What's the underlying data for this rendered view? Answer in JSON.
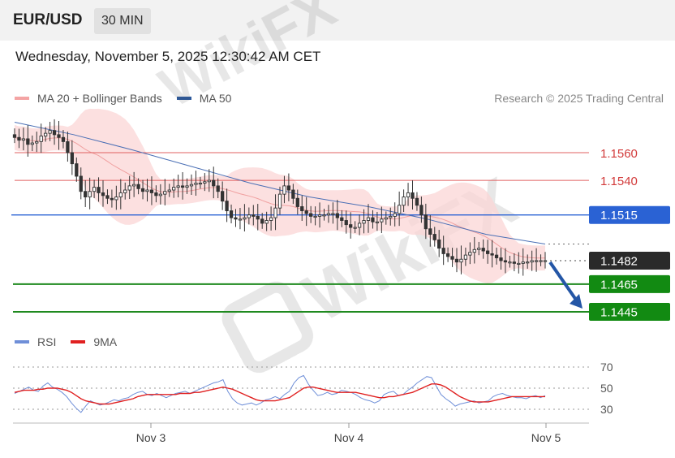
{
  "header": {
    "pair": "EUR/USD",
    "timeframe": "30 MIN",
    "timestamp": "Wednesday, November 5, 2025 12:30:42 AM CET"
  },
  "legend": {
    "ma20": {
      "label": "MA 20 + Bollinger Bands",
      "color": "#f4a4a4"
    },
    "ma50": {
      "label": "MA 50",
      "color": "#2c5aa0"
    }
  },
  "credit": "Research © 2025 Trading Central",
  "rsi_legend": {
    "rsi": {
      "label": "RSI",
      "color": "#6f8fd8"
    },
    "ma9": {
      "label": "9MA",
      "color": "#e02020"
    }
  },
  "watermark": "WikiFX",
  "chart_data": [
    {
      "type": "candlestick",
      "title": "",
      "ylim": [
        1.1425,
        1.1595
      ],
      "levels": [
        {
          "value": 1.156,
          "label": "1.1560",
          "kind": "resistance",
          "color": "#e06060"
        },
        {
          "value": 1.154,
          "label": "1.1540",
          "kind": "resistance",
          "color": "#e06060"
        },
        {
          "value": 1.1515,
          "label": "1.1515",
          "kind": "pivot",
          "color": "#2a62d4"
        },
        {
          "value": 1.1482,
          "label": "1.1482",
          "kind": "current",
          "color": "#2a2a2a"
        },
        {
          "value": 1.1465,
          "label": "1.1465",
          "kind": "support",
          "color": "#1f8a1f"
        },
        {
          "value": 1.1445,
          "label": "1.1445",
          "kind": "support",
          "color": "#1f8a1f"
        }
      ],
      "x_ticks": [
        {
          "label": "Nov 3",
          "index": 37
        },
        {
          "label": "Nov 4",
          "index": 85
        },
        {
          "value": "Nov 5",
          "label": "Nov 5",
          "index": 133
        }
      ],
      "close_series": [
        1.1571,
        1.1569,
        1.157,
        1.1566,
        1.1567,
        1.1568,
        1.1572,
        1.1574,
        1.1576,
        1.1573,
        1.1571,
        1.1568,
        1.156,
        1.1552,
        1.1543,
        1.1532,
        1.1528,
        1.1532,
        1.1535,
        1.1531,
        1.1529,
        1.1527,
        1.1526,
        1.1528,
        1.1531,
        1.1533,
        1.1536,
        1.1537,
        1.1534,
        1.1532,
        1.1533,
        1.1531,
        1.1529,
        1.153,
        1.1532,
        1.1533,
        1.1535,
        1.1536,
        1.1535,
        1.1536,
        1.1537,
        1.1538,
        1.1538,
        1.1539,
        1.154,
        1.1536,
        1.1532,
        1.1525,
        1.1518,
        1.1513,
        1.1512,
        1.1512,
        1.1513,
        1.1515,
        1.1514,
        1.1512,
        1.1509,
        1.1511,
        1.1513,
        1.152,
        1.153,
        1.1536,
        1.1533,
        1.1527,
        1.1521,
        1.1518,
        1.1516,
        1.1514,
        1.1514,
        1.1515,
        1.1515,
        1.1516,
        1.1516,
        1.1513,
        1.1511,
        1.1508,
        1.1506,
        1.1506,
        1.1509,
        1.1511,
        1.1513,
        1.151,
        1.151,
        1.1512,
        1.1513,
        1.1514,
        1.1516,
        1.1522,
        1.1528,
        1.1531,
        1.1527,
        1.1522,
        1.1515,
        1.1505,
        1.1501,
        1.1497,
        1.1491,
        1.1487,
        1.1485,
        1.1483,
        1.1481,
        1.1483,
        1.1486,
        1.1488,
        1.149,
        1.1491,
        1.1489,
        1.1487,
        1.1486,
        1.1484,
        1.1482,
        1.1481,
        1.1481,
        1.148,
        1.148,
        1.1481,
        1.1481,
        1.1482,
        1.1482,
        1.1482,
        1.1482
      ],
      "ma50_series": [
        1.1582,
        1.1573,
        1.1562,
        1.155,
        1.1538,
        1.1528,
        1.1521,
        1.1512,
        1.1501,
        1.1494
      ],
      "forecast_arrow": {
        "from": 1.1482,
        "to": 1.1445
      }
    },
    {
      "type": "line",
      "title": "",
      "ylim": [
        20,
        80
      ],
      "y_ticks": [
        70,
        50,
        30
      ],
      "series": [
        {
          "name": "RSI",
          "values": [
            45,
            47,
            49,
            51,
            48,
            47,
            52,
            55,
            51,
            49,
            46,
            42,
            36,
            31,
            27,
            33,
            38,
            36,
            34,
            35,
            37,
            39,
            38,
            40,
            41,
            44,
            46,
            47,
            44,
            43,
            45,
            43,
            41,
            43,
            45,
            46,
            47,
            45,
            47,
            49,
            51,
            53,
            55,
            56,
            58,
            47,
            40,
            36,
            34,
            35,
            36,
            34,
            36,
            39,
            40,
            42,
            40,
            44,
            47,
            55,
            60,
            62,
            54,
            48,
            43,
            44,
            46,
            44,
            45,
            48,
            47,
            46,
            44,
            41,
            39,
            38,
            36,
            38,
            44,
            46,
            47,
            43,
            44,
            48,
            51,
            55,
            58,
            61,
            60,
            52,
            44,
            40,
            37,
            33,
            35,
            36,
            37,
            38,
            36,
            37,
            38,
            42,
            44,
            45,
            43,
            42,
            41,
            41,
            40,
            42,
            43,
            41,
            43
          ]
        },
        {
          "name": "9MA",
          "values": [
            46,
            47,
            48,
            48,
            48,
            49,
            49,
            50,
            50,
            50,
            49,
            48,
            46,
            43,
            40,
            38,
            37,
            36,
            35,
            35,
            35,
            36,
            37,
            38,
            39,
            40,
            42,
            43,
            44,
            44,
            44,
            44,
            44,
            44,
            44,
            45,
            45,
            45,
            46,
            46,
            47,
            48,
            49,
            50,
            51,
            50,
            49,
            47,
            45,
            43,
            41,
            39,
            38,
            38,
            38,
            38,
            39,
            40,
            41,
            44,
            47,
            50,
            51,
            51,
            50,
            49,
            48,
            47,
            46,
            46,
            46,
            46,
            46,
            45,
            44,
            43,
            42,
            41,
            41,
            42,
            42,
            43,
            44,
            45,
            46,
            48,
            50,
            52,
            54,
            54,
            53,
            51,
            48,
            45,
            42,
            40,
            38,
            37,
            37,
            37,
            37,
            38,
            39,
            40,
            41,
            42,
            42,
            42,
            42,
            42,
            42,
            42,
            42
          ]
        }
      ]
    }
  ]
}
